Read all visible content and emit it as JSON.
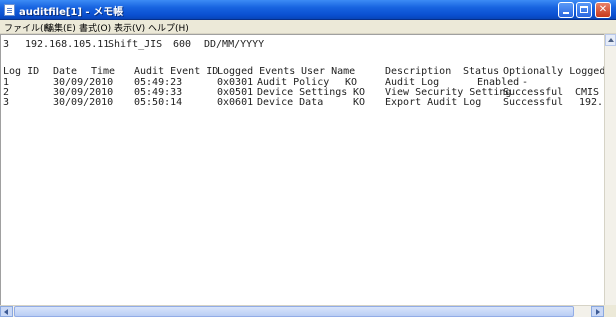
{
  "window": {
    "title": "auditfile[1] - メモ帳"
  },
  "menu": [
    "ファイル(F)",
    "編集(E)",
    "書式(O)",
    "表示(V)",
    "ヘルプ(H)"
  ],
  "header_line": [
    "3",
    "192.168.105.11",
    "Shift_JIS",
    "600",
    "DD/MM/YYYY"
  ],
  "columns": {
    "log_id": "Log ID",
    "date": "Date",
    "time": "Time",
    "audit_event_id": "Audit Event ID",
    "logged_events": "Logged Events",
    "user_name": "User Name",
    "description": "Description",
    "status": "Status",
    "optional": "Optionally Logged It"
  },
  "rows": [
    {
      "log_id": "1",
      "date": "30/09/2010",
      "time": "05:49:23",
      "event_id": "0x0301",
      "event": "Audit Policy",
      "user": "KO",
      "description": "Audit Log",
      "status": "Enabled",
      "optional": "-"
    },
    {
      "log_id": "2",
      "date": "30/09/2010",
      "time": "05:49:33",
      "event_id": "0x0501",
      "event": "Device Settings",
      "user": "KO",
      "description": "View Security Setting",
      "status": "Successful",
      "optional": "CMIS"
    },
    {
      "log_id": "3",
      "date": "30/09/2010",
      "time": "05:50:14",
      "event_id": "0x0601",
      "event": "Device Data",
      "user": "KO",
      "description": "Export Audit Log",
      "status": "Successful",
      "optional": "192."
    }
  ]
}
